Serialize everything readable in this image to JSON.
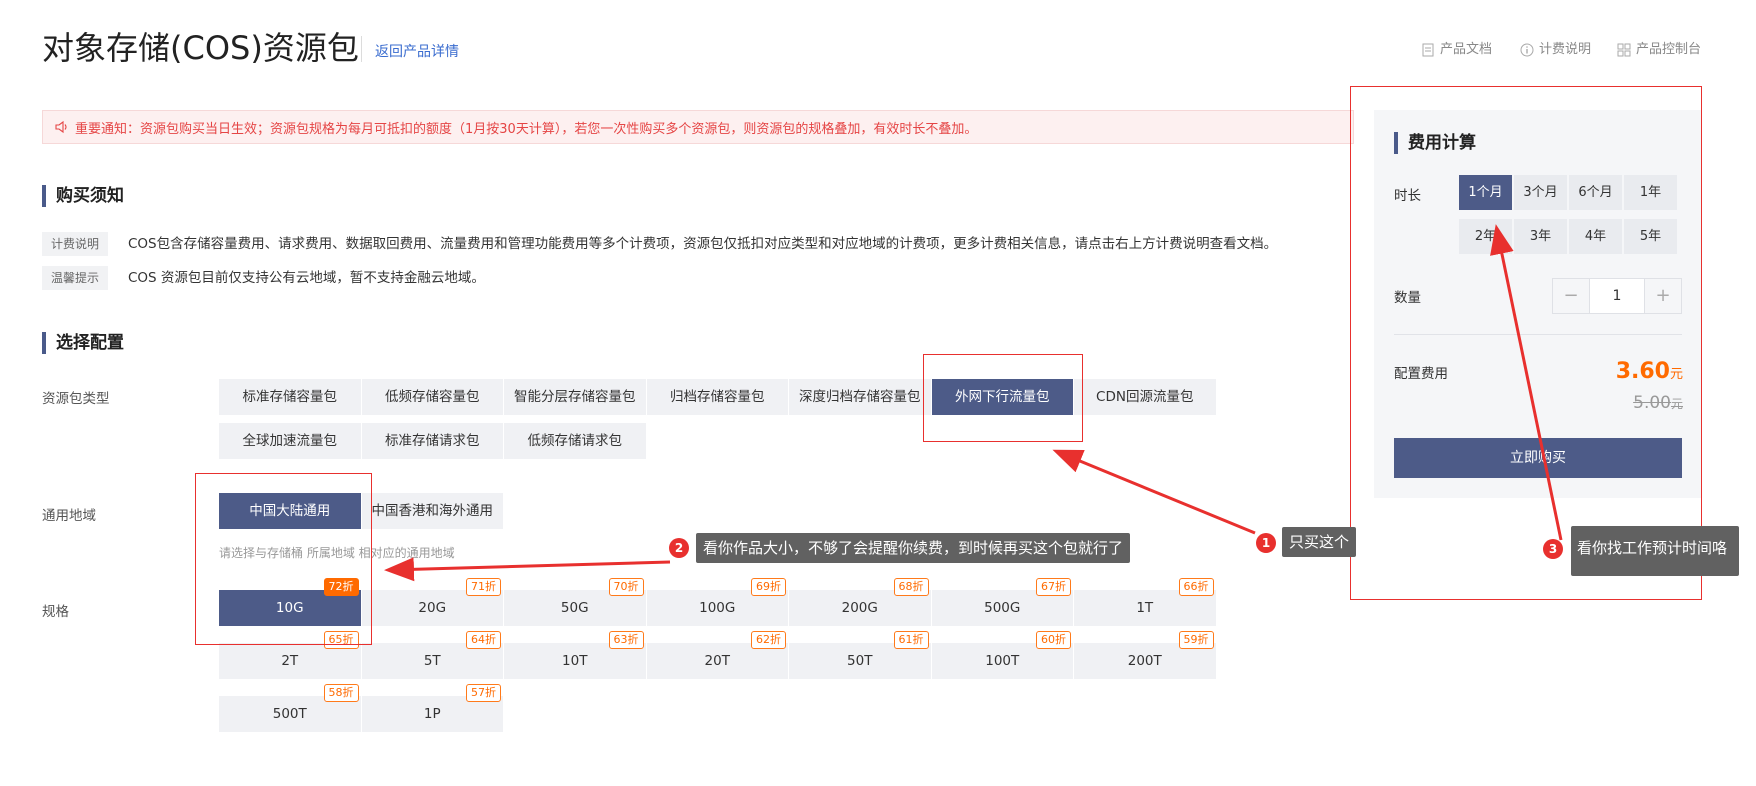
{
  "header": {
    "title": "对象存储(COS)资源包",
    "back_link": "返回产品详情",
    "links": [
      {
        "label": "产品文档",
        "icon": "document-icon"
      },
      {
        "label": "计费说明",
        "icon": "info-circle-icon"
      },
      {
        "label": "产品控制台",
        "icon": "grid-icon"
      }
    ]
  },
  "notice": {
    "icon": "speaker-icon",
    "text": "重要通知：资源包购买当日生效；资源包规格为每月可抵扣的额度（1月按30天计算），若您一次性购买多个资源包，则资源包的规格叠加，有效时长不叠加。"
  },
  "purchase_notes": {
    "title": "购买须知",
    "items": [
      {
        "tag": "计费说明",
        "text": "COS包含存储容量费用、请求费用、数据取回费用、流量费用和管理功能费用等多个计费项，资源包仅抵扣对应类型和对应地域的计费项，更多计费相关信息，请点击右上方计费说明查看文档。"
      },
      {
        "tag": "温馨提示",
        "text": "COS 资源包目前仅支持公有云地域，暂不支持金融云地域。"
      }
    ]
  },
  "config": {
    "title": "选择配置",
    "package_type": {
      "label": "资源包类型",
      "options": [
        "标准存储容量包",
        "低频存储容量包",
        "智能分层存储容量包",
        "归档存储容量包",
        "深度归档存储容量包",
        "外网下行流量包",
        "CDN回源流量包",
        "全球加速流量包",
        "标准存储请求包",
        "低频存储请求包"
      ],
      "selected": "外网下行流量包"
    },
    "region": {
      "label": "通用地域",
      "options": [
        "中国大陆通用",
        "中国香港和海外通用"
      ],
      "selected": "中国大陆通用",
      "hint": "请选择与存储桶 所属地域 相对应的通用地域"
    },
    "spec": {
      "label": "规格",
      "selected": "10G",
      "options": [
        {
          "size": "10G",
          "discount": "72折"
        },
        {
          "size": "20G",
          "discount": "71折"
        },
        {
          "size": "50G",
          "discount": "70折"
        },
        {
          "size": "100G",
          "discount": "69折"
        },
        {
          "size": "200G",
          "discount": "68折"
        },
        {
          "size": "500G",
          "discount": "67折"
        },
        {
          "size": "1T",
          "discount": "66折"
        },
        {
          "size": "2T",
          "discount": "65折"
        },
        {
          "size": "5T",
          "discount": "64折"
        },
        {
          "size": "10T",
          "discount": "63折"
        },
        {
          "size": "20T",
          "discount": "62折"
        },
        {
          "size": "50T",
          "discount": "61折"
        },
        {
          "size": "100T",
          "discount": "60折"
        },
        {
          "size": "200T",
          "discount": "59折"
        },
        {
          "size": "500T",
          "discount": "58折"
        },
        {
          "size": "1P",
          "discount": "57折"
        }
      ]
    }
  },
  "cost_panel": {
    "title": "费用计算",
    "duration_label": "时长",
    "durations": [
      "1个月",
      "3个月",
      "6个月",
      "1年",
      "2年",
      "3年",
      "4年",
      "5年"
    ],
    "selected_duration": "1个月",
    "quantity_label": "数量",
    "quantity_minus": "−",
    "quantity_plus": "+",
    "quantity": "1",
    "fee_label": "配置费用",
    "price": "3.60",
    "price_unit": "元",
    "original_price": "5.00",
    "original_unit": "元",
    "buy_button": "立即购买"
  },
  "annotations": [
    {
      "number": "1",
      "text": "只买这个"
    },
    {
      "number": "2",
      "text": "看你作品大小，不够了会提醒你续费，到时候再买这个包就行了"
    },
    {
      "number": "3",
      "text": "看你找工作预计时间咯"
    }
  ],
  "colors": {
    "primary": "#4d5b88",
    "accent_orange": "#ff6a00",
    "notice_red": "#e54545",
    "annotation_red": "#e8302e"
  }
}
